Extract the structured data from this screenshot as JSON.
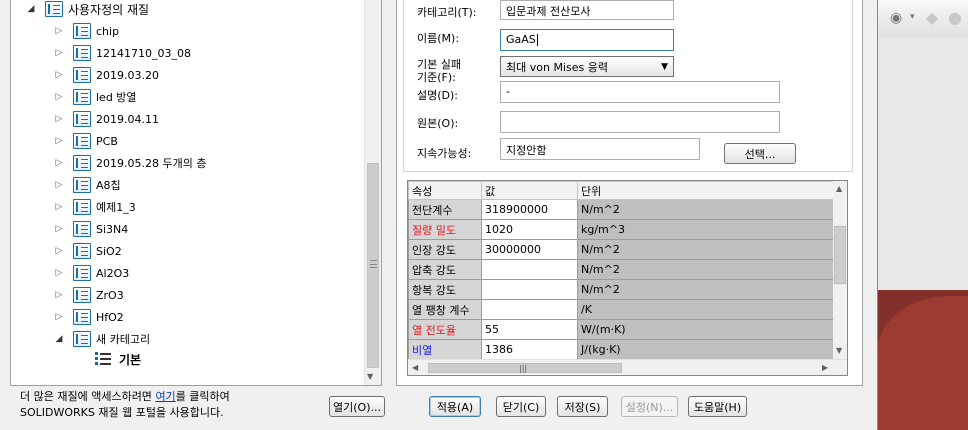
{
  "tree": {
    "root_label": "사용자정의 재질",
    "items": [
      {
        "label": "chip"
      },
      {
        "label": "12141710_03_08"
      },
      {
        "label": "2019.03.20"
      },
      {
        "label": "led 방열"
      },
      {
        "label": "2019.04.11"
      },
      {
        "label": "PCB"
      },
      {
        "label": "2019.05.28 두개의 층"
      },
      {
        "label": "A8칩"
      },
      {
        "label": "예제1_3"
      },
      {
        "label": "Si3N4"
      },
      {
        "label": "SiO2"
      },
      {
        "label": "Al2O3"
      },
      {
        "label": "ZrO3"
      },
      {
        "label": "HfO2"
      },
      {
        "label": "새 카테고리"
      }
    ],
    "selected_label": "기본"
  },
  "footer": {
    "text_before": "더 많은 재질에 액세스하려면 ",
    "link": "여기",
    "text_after": "를 클릭하여",
    "line2": "SOLIDWORKS 재질 웹 포털을 사용합니다."
  },
  "form": {
    "category_label": "카테고리(T):",
    "category_value": "입문과제 전산모사",
    "name_label": "이름(M):",
    "name_value": "GaAS",
    "failure_label_line1": "기본 실패",
    "failure_label_line2": "기준(F):",
    "failure_value": "최대 von Mises 응력",
    "description_label": "설명(D):",
    "description_value": "-",
    "source_label": "원본(O):",
    "source_value": "",
    "sustainability_label": "지속가능성:",
    "sustainability_value": "지정안함",
    "select_button": "선택..."
  },
  "table": {
    "headers": [
      "속성",
      "값",
      "단위"
    ],
    "rows": [
      {
        "name": "전단계수",
        "value": "318900000",
        "unit": "N/m^2",
        "color": "black"
      },
      {
        "name": "질량 밀도",
        "value": "1020",
        "unit": "kg/m^3",
        "color": "red"
      },
      {
        "name": "인장 강도",
        "value": "30000000",
        "unit": "N/m^2",
        "color": "black"
      },
      {
        "name": "압축 강도",
        "value": "",
        "unit": "N/m^2",
        "color": "black"
      },
      {
        "name": "항복 강도",
        "value": "",
        "unit": "N/m^2",
        "color": "black"
      },
      {
        "name": "열 팽창 계수",
        "value": "",
        "unit": "/K",
        "color": "black"
      },
      {
        "name": "열 전도율",
        "value": "55",
        "unit": "W/(m·K)",
        "color": "red"
      },
      {
        "name": "비열",
        "value": "1386",
        "unit": "J/(kg·K)",
        "color": "blue"
      }
    ]
  },
  "buttons": {
    "open": "열기(O)...",
    "apply": "적용(A)",
    "close": "닫기(C)",
    "save": "저장(S)",
    "config": "설정(N)...",
    "help": "도움말(H)"
  },
  "colors": {
    "required_red": "#e8141b",
    "optional_blue": "#1520e8",
    "link_blue": "#0645ad"
  }
}
